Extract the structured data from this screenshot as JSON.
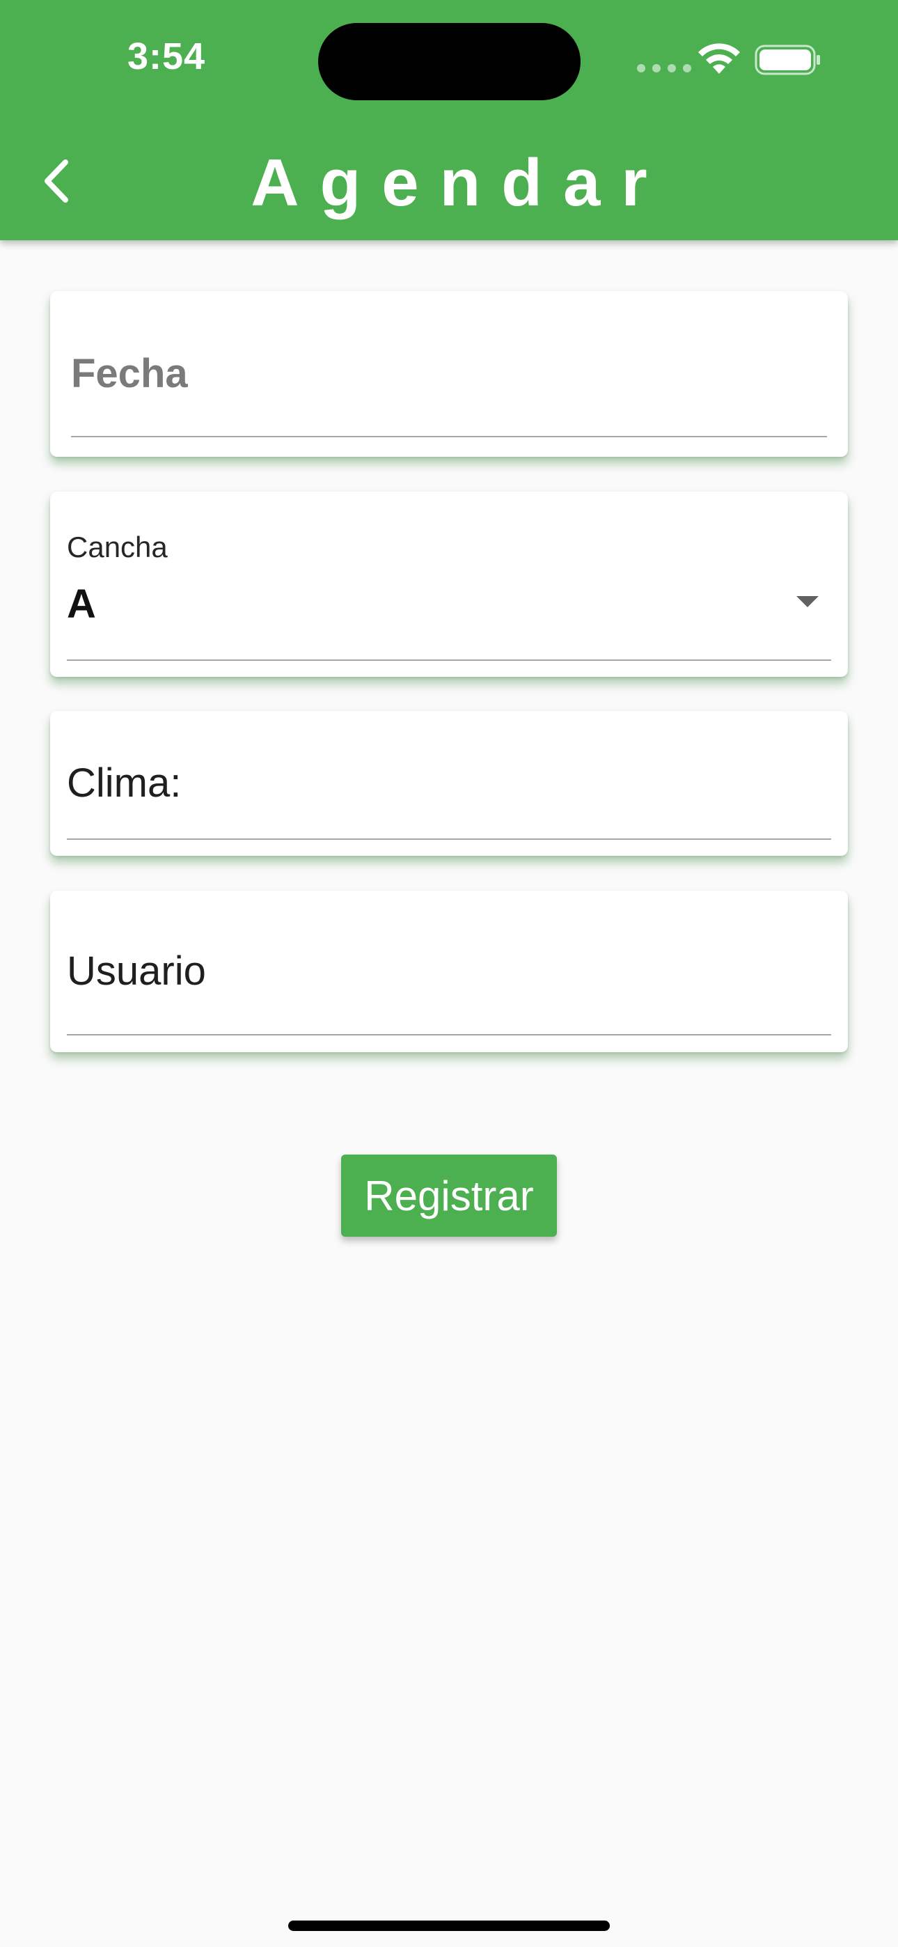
{
  "status_bar": {
    "time": "3:54"
  },
  "header": {
    "title": "Agendar",
    "back_icon": "chevron-left-icon",
    "color": "#4caf50"
  },
  "form": {
    "fecha": {
      "placeholder": "Fecha"
    },
    "cancha": {
      "label": "Cancha",
      "value": "A"
    },
    "clima": {
      "label": "Clima:"
    },
    "usuario": {
      "label": "Usuario"
    }
  },
  "actions": {
    "register_label": "Registrar"
  }
}
